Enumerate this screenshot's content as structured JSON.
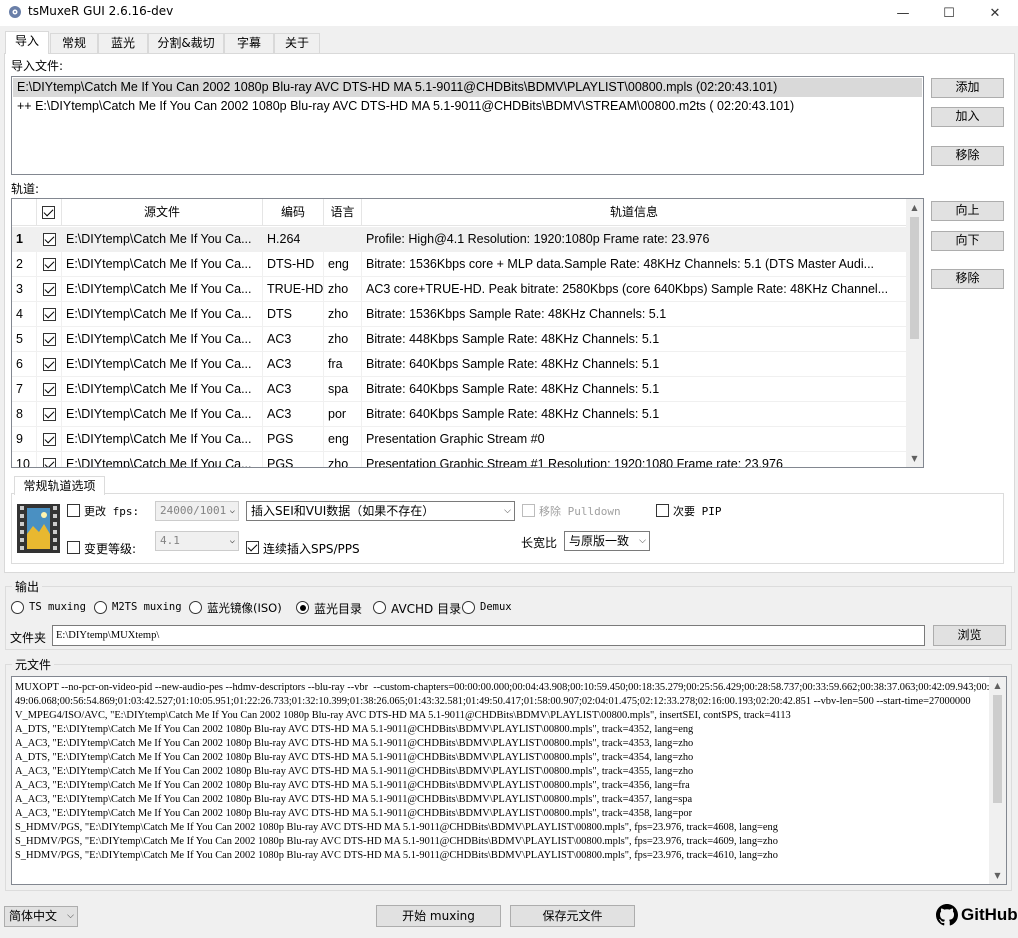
{
  "window": {
    "title": "tsMuxeR GUI 2.6.16-dev",
    "minimize": "—",
    "maximize": "☐",
    "close": "✕"
  },
  "tabs": [
    "导入",
    "常规",
    "蓝光",
    "分割&裁切",
    "字幕",
    "关于"
  ],
  "import": {
    "label": "导入文件:",
    "files": [
      "E:\\DIYtemp\\Catch Me If You Can 2002 1080p Blu-ray AVC DTS-HD MA 5.1-9011@CHDBits\\BDMV\\PLAYLIST\\00800.mpls (02:20:43.101)",
      " ++ E:\\DIYtemp\\Catch Me If You Can 2002 1080p Blu-ray AVC DTS-HD MA 5.1-9011@CHDBits\\BDMV\\STREAM\\00800.m2ts ( 02:20:43.101)"
    ],
    "add_button": "添加",
    "append_button": "加入",
    "remove_button": "移除"
  },
  "tracks": {
    "label": "轨道:",
    "headers": [
      "源文件",
      "编码",
      "语言",
      "轨道信息"
    ],
    "up_button": "向上",
    "down_button": "向下",
    "remove_button": "移除",
    "rows": [
      {
        "n": "1",
        "src": "E:\\DIYtemp\\Catch Me If You Ca...",
        "codec": "H.264",
        "lang": "",
        "info": "Profile: High@4.1  Resolution: 1920:1080p  Frame rate: 23.976"
      },
      {
        "n": "2",
        "src": "E:\\DIYtemp\\Catch Me If You Ca...",
        "codec": "DTS-HD",
        "lang": "eng",
        "info": "Bitrate: 1536Kbps  core + MLP data.Sample Rate: 48KHz  Channels: 5.1 (DTS Master Audi..."
      },
      {
        "n": "3",
        "src": "E:\\DIYtemp\\Catch Me If You Ca...",
        "codec": "TRUE-HD",
        "lang": "zho",
        "info": "AC3 core+TRUE-HD. Peak bitrate: 2580Kbps (core 640Kbps) Sample Rate: 48KHz Channel..."
      },
      {
        "n": "4",
        "src": "E:\\DIYtemp\\Catch Me If You Ca...",
        "codec": "DTS",
        "lang": "zho",
        "info": "Bitrate: 1536Kbps  Sample Rate: 48KHz  Channels: 5.1"
      },
      {
        "n": "5",
        "src": "E:\\DIYtemp\\Catch Me If You Ca...",
        "codec": "AC3",
        "lang": "zho",
        "info": "Bitrate: 448Kbps Sample Rate: 48KHz Channels: 5.1"
      },
      {
        "n": "6",
        "src": "E:\\DIYtemp\\Catch Me If You Ca...",
        "codec": "AC3",
        "lang": "fra",
        "info": "Bitrate: 640Kbps Sample Rate: 48KHz Channels: 5.1"
      },
      {
        "n": "7",
        "src": "E:\\DIYtemp\\Catch Me If You Ca...",
        "codec": "AC3",
        "lang": "spa",
        "info": "Bitrate: 640Kbps Sample Rate: 48KHz Channels: 5.1"
      },
      {
        "n": "8",
        "src": "E:\\DIYtemp\\Catch Me If You Ca...",
        "codec": "AC3",
        "lang": "por",
        "info": "Bitrate: 640Kbps Sample Rate: 48KHz Channels: 5.1"
      },
      {
        "n": "9",
        "src": "E:\\DIYtemp\\Catch Me If You Ca...",
        "codec": "PGS",
        "lang": "eng",
        "info": "Presentation Graphic Stream #0"
      },
      {
        "n": "10",
        "src": "E:\\DIYtemp\\Catch Me If You Ca...",
        "codec": "PGS",
        "lang": "zho",
        "info": "Presentation Graphic Stream #1 Resolution: 1920:1080 Frame rate: 23.976"
      }
    ]
  },
  "track_options": {
    "tab": "常规轨道选项",
    "change_fps": "更改 fps:",
    "fps_value": "24000/1001",
    "sei_value": "插入SEI和VUI数据（如果不存在）",
    "remove_pulldown": "移除 Pulldown",
    "secondary_pip": "次要 PIP",
    "change_level": "变更等级:",
    "level_value": "4.1",
    "insert_sps": "连续插入SPS/PPS",
    "aspect_label": "长宽比",
    "aspect_value": "与原版一致"
  },
  "output": {
    "label": "输出",
    "modes": [
      "TS muxing",
      "M2TS muxing",
      "蓝光镜像(ISO)",
      "蓝光目录",
      "AVCHD 目录",
      "Demux"
    ],
    "selected": "蓝光目录",
    "folder_label": "文件夹",
    "folder_value": "E:\\DIYtemp\\MUXtemp\\",
    "browse_button": "浏览"
  },
  "meta": {
    "label": "元文件",
    "text": "MUXOPT --no-pcr-on-video-pid --new-audio-pes --hdmv-descriptors --blu-ray --vbr  --custom-chapters=00:00:00.000;00:04:43.908;00:10:59.450;00:18:35.279;00:25:56.429;00:28:58.737;00:33:59.662;00:38:37.063;00:42:09.943;00:49:06.068;00:56:54.869;01:03:42.527;01:10:05.951;01:22:26.733;01:32:10.399;01:38:26.065;01:43:32.581;01:49:50.417;01:58:00.907;02:04:01.475;02:12:33.278;02:16:00.193;02:20:42.851 --vbv-len=500 --start-time=27000000\nV_MPEG4/ISO/AVC, \"E:\\DIYtemp\\Catch Me If You Can 2002 1080p Blu-ray AVC DTS-HD MA 5.1-9011@CHDBits\\BDMV\\PLAYLIST\\00800.mpls\", insertSEI, contSPS, track=4113\nA_DTS, \"E:\\DIYtemp\\Catch Me If You Can 2002 1080p Blu-ray AVC DTS-HD MA 5.1-9011@CHDBits\\BDMV\\PLAYLIST\\00800.mpls\", track=4352, lang=eng\nA_AC3, \"E:\\DIYtemp\\Catch Me If You Can 2002 1080p Blu-ray AVC DTS-HD MA 5.1-9011@CHDBits\\BDMV\\PLAYLIST\\00800.mpls\", track=4353, lang=zho\nA_DTS, \"E:\\DIYtemp\\Catch Me If You Can 2002 1080p Blu-ray AVC DTS-HD MA 5.1-9011@CHDBits\\BDMV\\PLAYLIST\\00800.mpls\", track=4354, lang=zho\nA_AC3, \"E:\\DIYtemp\\Catch Me If You Can 2002 1080p Blu-ray AVC DTS-HD MA 5.1-9011@CHDBits\\BDMV\\PLAYLIST\\00800.mpls\", track=4355, lang=zho\nA_AC3, \"E:\\DIYtemp\\Catch Me If You Can 2002 1080p Blu-ray AVC DTS-HD MA 5.1-9011@CHDBits\\BDMV\\PLAYLIST\\00800.mpls\", track=4356, lang=fra\nA_AC3, \"E:\\DIYtemp\\Catch Me If You Can 2002 1080p Blu-ray AVC DTS-HD MA 5.1-9011@CHDBits\\BDMV\\PLAYLIST\\00800.mpls\", track=4357, lang=spa\nA_AC3, \"E:\\DIYtemp\\Catch Me If You Can 2002 1080p Blu-ray AVC DTS-HD MA 5.1-9011@CHDBits\\BDMV\\PLAYLIST\\00800.mpls\", track=4358, lang=por\nS_HDMV/PGS, \"E:\\DIYtemp\\Catch Me If You Can 2002 1080p Blu-ray AVC DTS-HD MA 5.1-9011@CHDBits\\BDMV\\PLAYLIST\\00800.mpls\", fps=23.976, track=4608, lang=eng\nS_HDMV/PGS, \"E:\\DIYtemp\\Catch Me If You Can 2002 1080p Blu-ray AVC DTS-HD MA 5.1-9011@CHDBits\\BDMV\\PLAYLIST\\00800.mpls\", fps=23.976, track=4609, lang=zho\nS_HDMV/PGS, \"E:\\DIYtemp\\Catch Me If You Can 2002 1080p Blu-ray AVC DTS-HD MA 5.1-9011@CHDBits\\BDMV\\PLAYLIST\\00800.mpls\", fps=23.976, track=4610, lang=zho"
  },
  "footer": {
    "language": "简体中文",
    "start_button": "开始 muxing",
    "save_button": "保存元文件",
    "github": "GitHub"
  },
  "colors": {
    "selection": "#cce8ff",
    "border": "#828790",
    "button": "#e1e1e1"
  }
}
